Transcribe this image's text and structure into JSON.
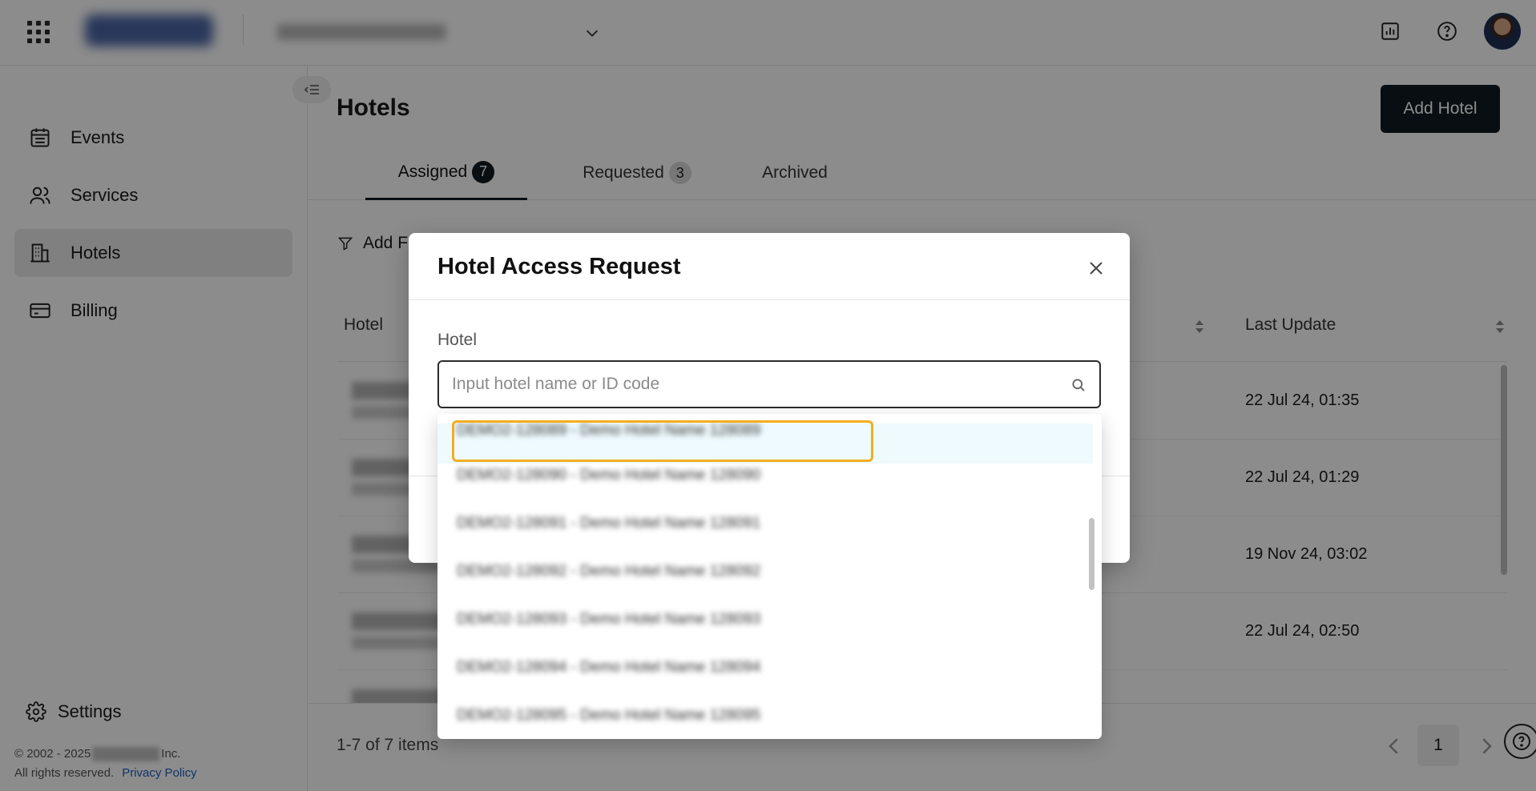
{
  "sidebar": {
    "items": [
      {
        "label": "Events",
        "icon": "calendar-icon"
      },
      {
        "label": "Services",
        "icon": "users-icon"
      },
      {
        "label": "Hotels",
        "icon": "building-icon"
      },
      {
        "label": "Billing",
        "icon": "credit-card-icon"
      }
    ],
    "active": "Hotels",
    "settings_label": "Settings",
    "copyright_prefix": "© 2002 - 2025",
    "copyright_suffix": "Inc.",
    "rights": "All rights reserved.",
    "privacy_label": "Privacy Policy"
  },
  "main": {
    "title": "Hotels",
    "add_button": "Add Hotel",
    "tabs": [
      {
        "label": "Assigned",
        "count": "7",
        "active": true
      },
      {
        "label": "Requested",
        "count": "3",
        "active": false
      },
      {
        "label": "Archived",
        "count": "",
        "active": false
      }
    ],
    "filter_label": "Add F",
    "columns": {
      "hotel": "Hotel",
      "last_update": "Last Update"
    },
    "rows": [
      {
        "last_update": "22 Jul 24, 01:35"
      },
      {
        "last_update": "22 Jul 24, 01:29"
      },
      {
        "last_update": "19 Nov 24, 03:02"
      },
      {
        "last_update": "22 Jul 24, 02:50"
      }
    ],
    "items_count": "1-7 of 7 items",
    "current_page": "1"
  },
  "modal": {
    "title": "Hotel Access Request",
    "field_label": "Hotel",
    "input_placeholder": "Input hotel name or ID code",
    "input_value": ""
  },
  "dropdown": {
    "options": [
      "DEMO2-128089 - Demo Hotel Name 128089",
      "DEMO2-128090 - Demo Hotel Name 128090",
      "DEMO2-128091 - Demo Hotel Name 128091",
      "DEMO2-128092 - Demo Hotel Name 128092",
      "DEMO2-128093 - Demo Hotel Name 128093",
      "DEMO2-128094 - Demo Hotel Name 128094",
      "DEMO2-128095 - Demo Hotel Name 128095"
    ],
    "hovered_index": 0
  },
  "colors": {
    "primary": "#0f1a1f",
    "highlight": "#f2ae22",
    "option_hover": "#eefafd",
    "link": "#1f5fbf"
  }
}
